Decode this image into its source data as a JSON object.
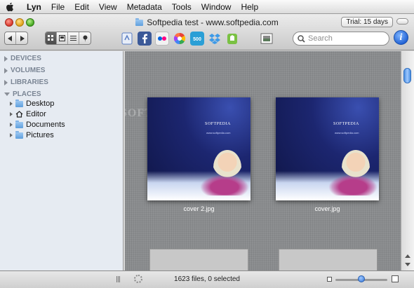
{
  "menubar": {
    "items": [
      "Lyn",
      "File",
      "Edit",
      "View",
      "Metadata",
      "Tools",
      "Window",
      "Help"
    ]
  },
  "window": {
    "title": "Softpedia test - www.softpedia.com",
    "trial": "Trial: 15 days"
  },
  "toolbar": {
    "view_modes": [
      "grid-view-icon",
      "split-view-icon",
      "list-view-icon",
      "map-view-icon"
    ],
    "active_view": 0,
    "share_services": [
      {
        "icon": "export-icon",
        "color": "#5b7fc4"
      },
      {
        "icon": "facebook-icon",
        "color": "#3b5998"
      },
      {
        "icon": "flickr-icon",
        "color": "#ff0084"
      },
      {
        "icon": "picasa-icon",
        "color": "#34a853"
      },
      {
        "icon": "500px-icon",
        "color": "#2a9fd6"
      },
      {
        "icon": "dropbox-icon",
        "color": "#3d9ae8"
      },
      {
        "icon": "evernote-icon",
        "color": "#7ac143"
      }
    ],
    "search_placeholder": "Search"
  },
  "sidebar": {
    "sections": [
      "DEVICES",
      "VOLUMES",
      "LIBRARIES",
      "PLACES"
    ],
    "places": [
      "Desktop",
      "Editor",
      "Documents",
      "Pictures"
    ]
  },
  "content": {
    "watermark": "SOFTPEDIA",
    "thumbnails": [
      {
        "filename": "cover 2.jpg",
        "brand": "SOFTPEDIA",
        "tagline": "www.softpedia.com"
      },
      {
        "filename": "cover.jpg",
        "brand": "SOFTPEDIA",
        "tagline": "www.softpedia.com"
      }
    ]
  },
  "status": {
    "text": "1623 files, 0 selected",
    "zoom_level": 0.5
  }
}
